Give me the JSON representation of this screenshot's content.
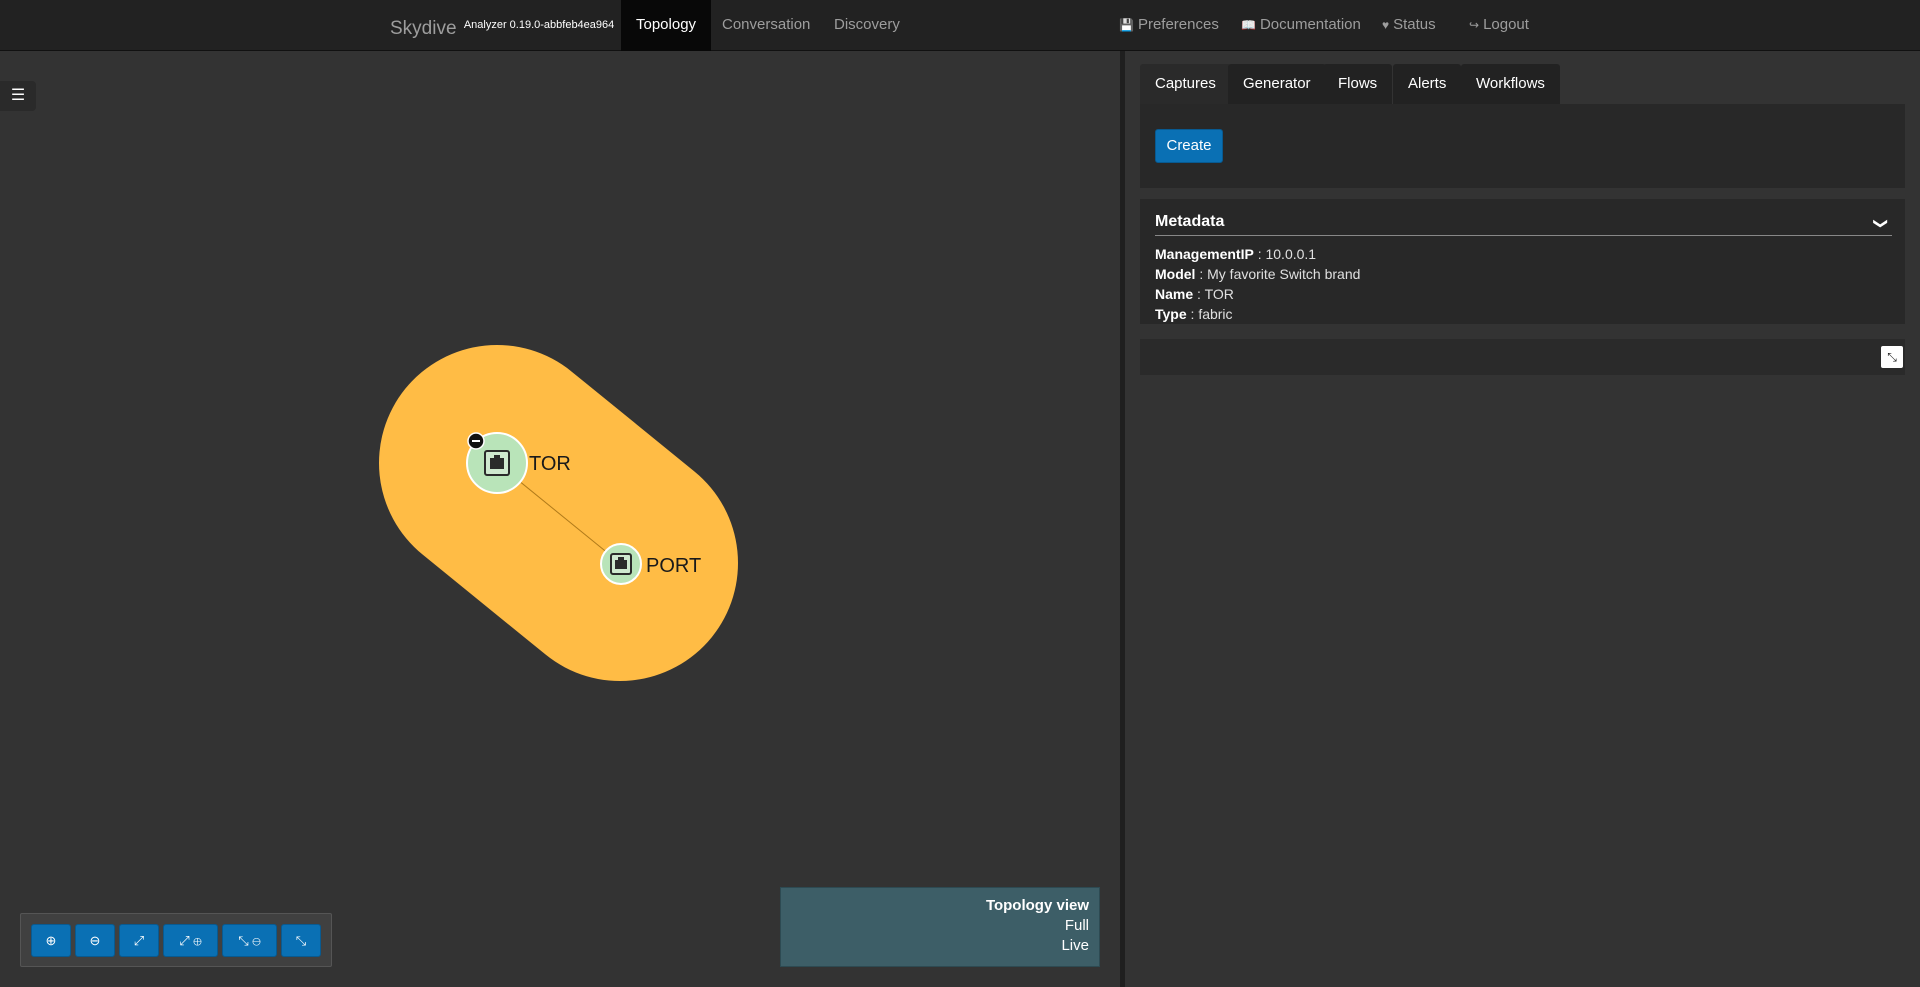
{
  "navbar": {
    "brand": "Skydive",
    "version": "Analyzer 0.19.0-abbfeb4ea964",
    "tabs": [
      {
        "label": "Topology",
        "active": true
      },
      {
        "label": "Conversation",
        "active": false
      },
      {
        "label": "Discovery",
        "active": false
      }
    ],
    "right": [
      {
        "label": "Preferences",
        "icon": "floppy-icon"
      },
      {
        "label": "Documentation",
        "icon": "book-icon"
      },
      {
        "label": "Status",
        "icon": "heartbeat-icon"
      },
      {
        "label": "Logout",
        "icon": "sign-out-icon"
      }
    ]
  },
  "topology": {
    "nodes": [
      {
        "label": "TOR",
        "icon": "switch-icon"
      },
      {
        "label": "PORT",
        "icon": "switch-icon"
      }
    ],
    "group_color": "#ffbc45",
    "node_color": "#b9e4b9",
    "view": {
      "title": "Topology view",
      "mode": "Full",
      "status": "Live"
    },
    "toolbar": [
      {
        "name": "zoom-in-button",
        "icon": "zoom-in-icon"
      },
      {
        "name": "zoom-out-button",
        "icon": "zoom-out-icon"
      },
      {
        "name": "zoom-fit-button",
        "icon": "expand-icon"
      },
      {
        "name": "expand-all-button",
        "icon": "expand-plus-icon"
      },
      {
        "name": "collapse-all-button",
        "icon": "collapse-minus-icon"
      },
      {
        "name": "compress-button",
        "icon": "compress-icon"
      }
    ]
  },
  "panel": {
    "tabs": [
      {
        "label": "Captures",
        "active": true
      },
      {
        "label": "Generator",
        "active": false
      },
      {
        "label": "Flows",
        "active": false
      },
      {
        "label": "Alerts",
        "active": false
      },
      {
        "label": "Workflows",
        "active": false
      }
    ],
    "create_label": "Create",
    "metadata": {
      "title": "Metadata",
      "rows": [
        {
          "key": "ManagementIP",
          "value": "10.0.0.1"
        },
        {
          "key": "Model",
          "value": "My favorite Switch brand"
        },
        {
          "key": "Name",
          "value": "TOR"
        },
        {
          "key": "Type",
          "value": "fabric"
        }
      ]
    }
  },
  "colors": {
    "accent": "#0a70b4",
    "navbar": "#222222",
    "background": "#333333"
  }
}
